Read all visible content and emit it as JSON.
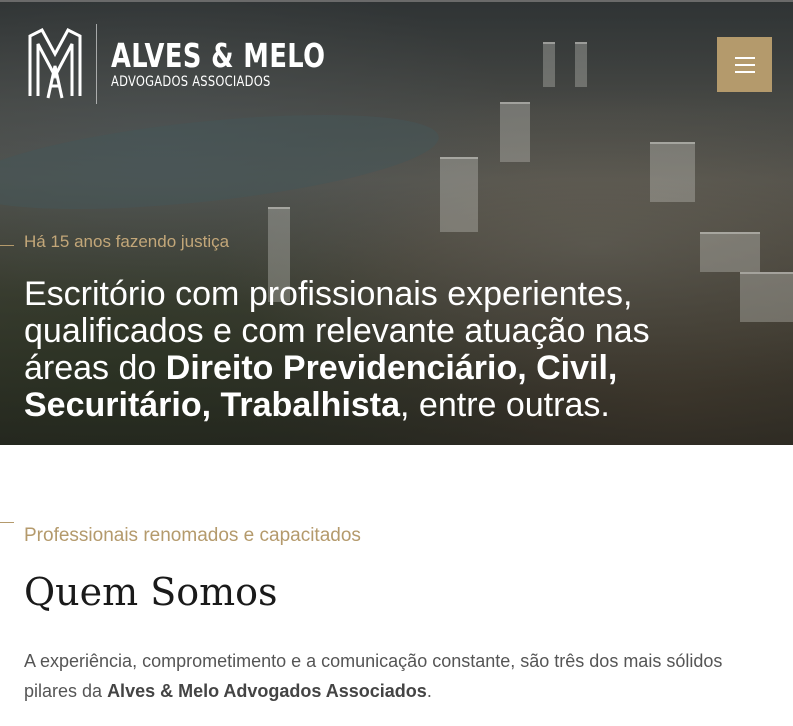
{
  "header": {
    "logo_title": "ALVES & MELO",
    "logo_subtitle": "ADVOGADOS ASSOCIADOS",
    "menu_icon": "hamburger-menu-icon"
  },
  "hero": {
    "eyebrow": "Há 15 anos fazendo justiça",
    "heading_part1": "Escritório com profissionais experientes, qualificados e com relevante atuação nas áreas do ",
    "heading_bold": "Direito Previdenciário, Civil, Securitário, Trabalhista",
    "heading_part2": ", entre outras."
  },
  "about": {
    "eyebrow": "Professionais renomados e capacitados",
    "title": "Quem Somos",
    "body_part1": "A experiência, comprometimento e a comunicação constante, são três dos mais sólidos pilares da ",
    "body_bold": "Alves & Melo Advogados Associados",
    "body_part2": "."
  },
  "colors": {
    "accent_gold": "#b49a6c",
    "eyebrow_gold": "#c3a779",
    "title_dark": "#1a1a1a",
    "body_gray": "#555555"
  }
}
